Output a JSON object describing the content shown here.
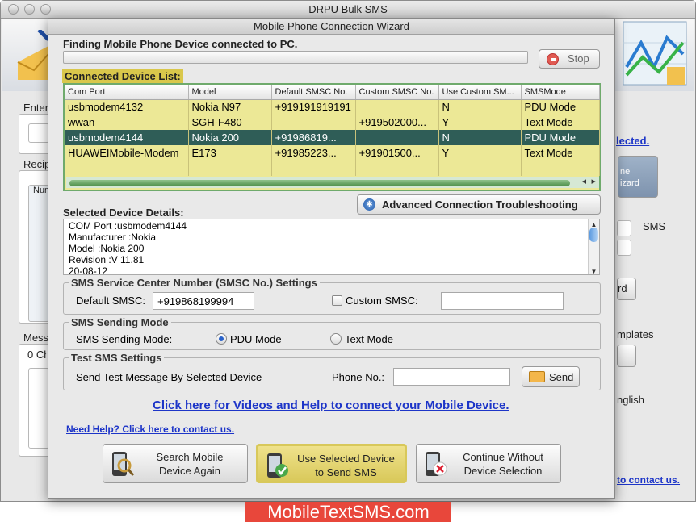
{
  "main_window": {
    "title": "DRPU Bulk SMS",
    "bg_labels": {
      "enter": "Enter",
      "recip": "Recip",
      "num": "Num",
      "mess": "Messa",
      "zero_ch": "0 Ch",
      "selected_link": "lected.",
      "sms": "SMS",
      "ne_wizard": "ne\nizard",
      "rd": "rd",
      "templates": "mplates",
      "english": "nglish",
      "contact_link": "to contact us."
    }
  },
  "wizard": {
    "title": "Mobile Phone Connection Wizard",
    "finding_label": "Finding Mobile Phone Device connected to PC.",
    "stop_label": "Stop",
    "progress": 0,
    "device_list_label": "Connected Device List:",
    "columns": [
      "Com Port",
      "Model",
      "Default SMSC No.",
      "Custom SMSC No.",
      "Use Custom SM...",
      "SMSMode"
    ],
    "rows": [
      [
        "usbmodem4132",
        "Nokia N97",
        "+919191919191",
        "",
        "N",
        "PDU Mode"
      ],
      [
        "wwan",
        "SGH-F480",
        "",
        "+919502000...",
        "Y",
        "Text Mode"
      ],
      [
        "usbmodem4144",
        "Nokia 200",
        "+91986819...",
        "",
        "N",
        "PDU Mode"
      ],
      [
        "HUAWEIMobile-Modem",
        "E173",
        "+91985223...",
        "+91901500...",
        "Y",
        "Text Mode"
      ],
      [
        "",
        "",
        "",
        "",
        "",
        ""
      ]
    ],
    "selected_row": 2,
    "advanced_button": "Advanced Connection Troubleshooting",
    "selected_details_label": "Selected Device Details:",
    "details_lines": [
      "COM Port :usbmodem4144",
      "Manufacturer :Nokia",
      "Model :Nokia 200",
      "Revision :V 11.81",
      "20-08-12"
    ],
    "smsc": {
      "legend": "SMS Service Center Number (SMSC No.) Settings",
      "default_label": "Default SMSC:",
      "default_value": "+919868199994",
      "custom_label": "Custom SMSC:",
      "custom_value": "",
      "custom_checked": false
    },
    "sending_mode": {
      "legend": "SMS Sending Mode",
      "label": "SMS Sending Mode:",
      "pdu_label": "PDU Mode",
      "text_label": "Text Mode",
      "selected": "PDU Mode"
    },
    "test_sms": {
      "legend": "Test SMS Settings",
      "send_label": "Send Test Message By Selected Device",
      "phone_label": "Phone No.:",
      "phone_value": "",
      "send_button": "Send"
    },
    "help_link": "Click here for Videos and Help to connect your Mobile Device.",
    "need_help_link": "Need Help? Click here to contact us.",
    "buttons": {
      "search": "Search Mobile\nDevice Again",
      "use_selected": "Use Selected Device\nto Send SMS",
      "continue": "Continue Without\nDevice Selection"
    }
  },
  "watermark": "MobileTextSMS.com",
  "colors": {
    "list_bg": "#ece896",
    "selected_row": "#2f5d57",
    "list_label_bg": "#d9c74b",
    "highlight_button": "#e3d36a",
    "link": "#1d35c8",
    "watermark_bg": "#e8473b"
  }
}
